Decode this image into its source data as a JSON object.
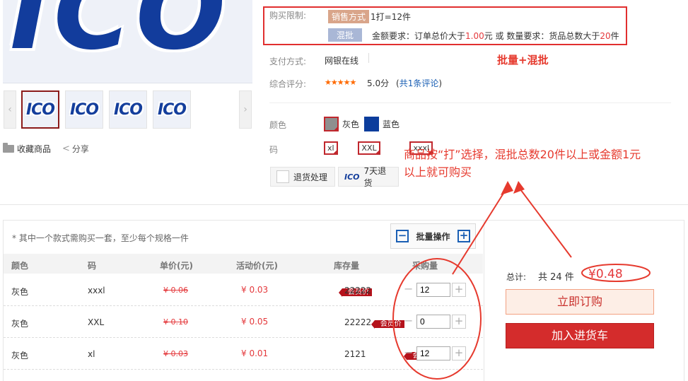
{
  "gallery": {
    "main_logo_text": "ICO",
    "thumbs": [
      "ICO",
      "ICO",
      "ICO",
      "ICO"
    ],
    "prev_glyph": "‹",
    "next_glyph": "›",
    "favorite_label": "收藏商品",
    "share_label": "分享"
  },
  "limit": {
    "label": "购买限制:",
    "sale_tag": "销售方式",
    "sale_value": "1打=12件",
    "mixed_tag": "混批",
    "req_prefix": "金额要求：订单总价大于",
    "req_amount": "1.00",
    "req_mid": "元 或 数量要求：货品总数大于",
    "req_count": "20",
    "req_suffix": "件"
  },
  "payment": {
    "label": "支付方式:",
    "value": "网银在线"
  },
  "rating": {
    "label": "综合评分:",
    "stars": "★★★★★",
    "score": "5.0分",
    "reviews_open": "(",
    "reviews_link": "共1条评论",
    "reviews_close": ")"
  },
  "color_opts": {
    "label": "颜色",
    "options": [
      "灰色",
      "蓝色"
    ]
  },
  "size_opts": {
    "label": "码",
    "options": [
      "xl",
      "XXL",
      "xxxl"
    ]
  },
  "services": [
    {
      "label": "退货处理"
    },
    {
      "badge": "ICO",
      "label": "7天退货"
    }
  ],
  "annotations": {
    "batch_mix": "批量+混批",
    "rule_line1": "商品按“打”选择，混批总数20件以上或金额1元",
    "rule_line2": "以上就可购买"
  },
  "order": {
    "note": "* 其中一个款式需购买一套，至少每个规格一件",
    "bulk_label": "批量操作",
    "bulk_minus": "−",
    "bulk_plus": "+",
    "headers": [
      "颜色",
      "码",
      "单价(元)",
      "活动价(元)",
      "库存量",
      "采购量"
    ],
    "rows": [
      {
        "color": "灰色",
        "size": "xxxl",
        "price": "¥ 0.06",
        "promo": "¥ 0.03",
        "badge": "会员价",
        "stock": "22222",
        "qty": "12"
      },
      {
        "color": "灰色",
        "size": "XXL",
        "price": "¥ 0.10",
        "promo": "¥ 0.05",
        "badge": "会员价",
        "stock": "22222",
        "qty": "0"
      },
      {
        "color": "灰色",
        "size": "xl",
        "price": "¥ 0.03",
        "promo": "¥ 0.01",
        "badge": "会员价",
        "stock": "2121",
        "qty": "12"
      }
    ],
    "stepper_minus": "−",
    "stepper_plus": "+"
  },
  "summary": {
    "total_label": "总计:",
    "total_count": "共 24 件",
    "total_amount": "¥0.48",
    "order_button": "立即订购",
    "cart_button": "加入进货车"
  },
  "colors": {
    "accent_red": "#e4393c",
    "annotation_red": "#e63a2e",
    "brand_blue": "#123c9c"
  }
}
